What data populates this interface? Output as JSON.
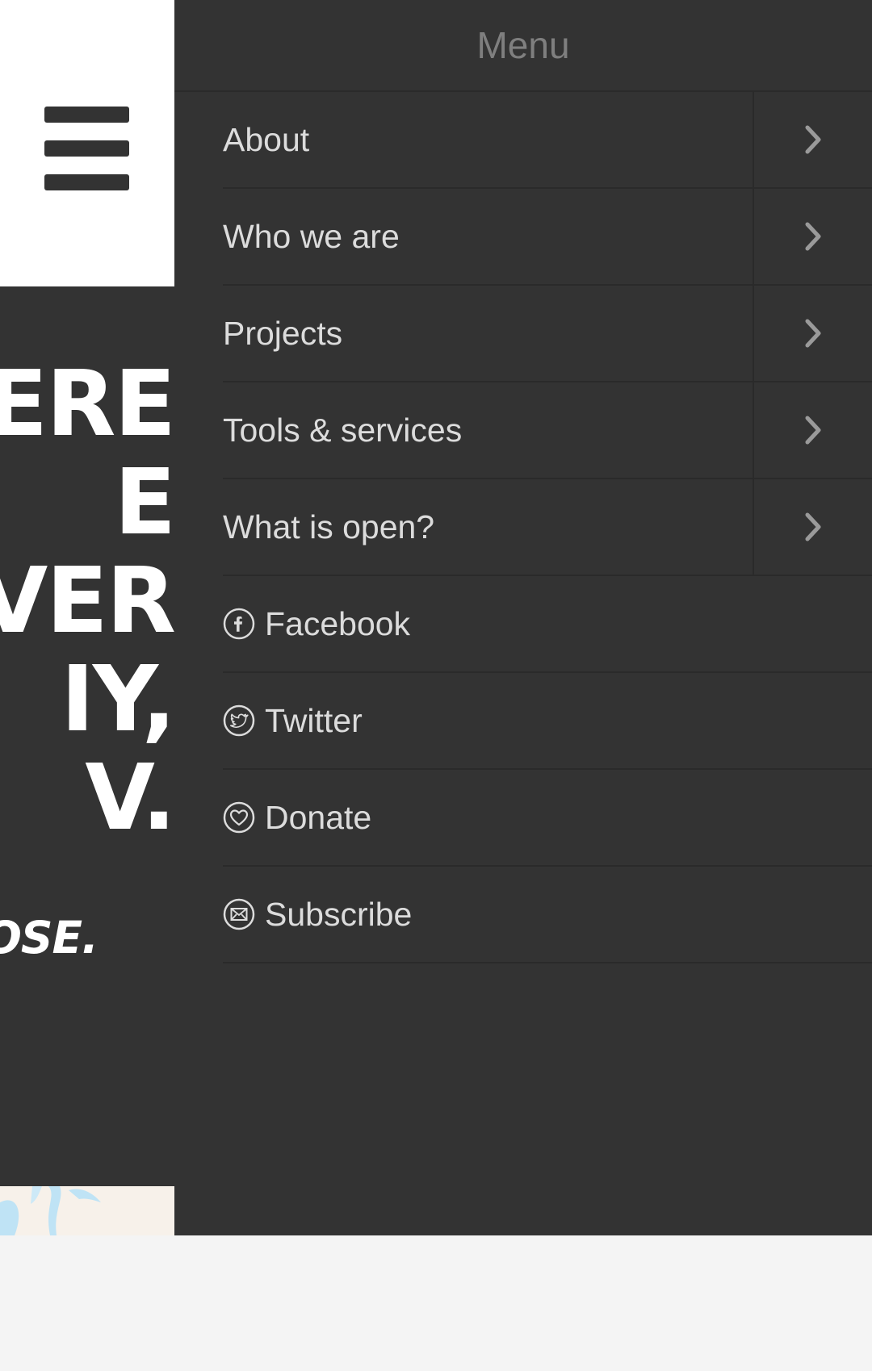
{
  "drawer": {
    "title": "Menu",
    "nav_items": [
      {
        "label": "About",
        "icon": "chevron-right-icon"
      },
      {
        "label": "Who we are",
        "icon": "chevron-right-icon"
      },
      {
        "label": "Projects",
        "icon": "chevron-right-icon"
      },
      {
        "label": "Tools & services",
        "icon": "chevron-right-icon"
      },
      {
        "label": "What is open?",
        "icon": "chevron-right-icon"
      }
    ],
    "links": [
      {
        "label": "Facebook",
        "icon": "facebook-icon"
      },
      {
        "label": "Twitter",
        "icon": "twitter-icon"
      },
      {
        "label": "Donate",
        "icon": "heart-icon"
      },
      {
        "label": "Subscribe",
        "icon": "envelope-icon"
      }
    ]
  },
  "background_page": {
    "hero_lines": "ERE\nE\nVER\nIY,\nV.",
    "hero_subtitle": "OSE."
  },
  "colors": {
    "drawer_bg": "#333333",
    "divider": "#2a2a2a",
    "menu_text": "#dcdcdc",
    "menu_title": "#7f7f7f",
    "page_bottom": "#f4f4f4"
  }
}
